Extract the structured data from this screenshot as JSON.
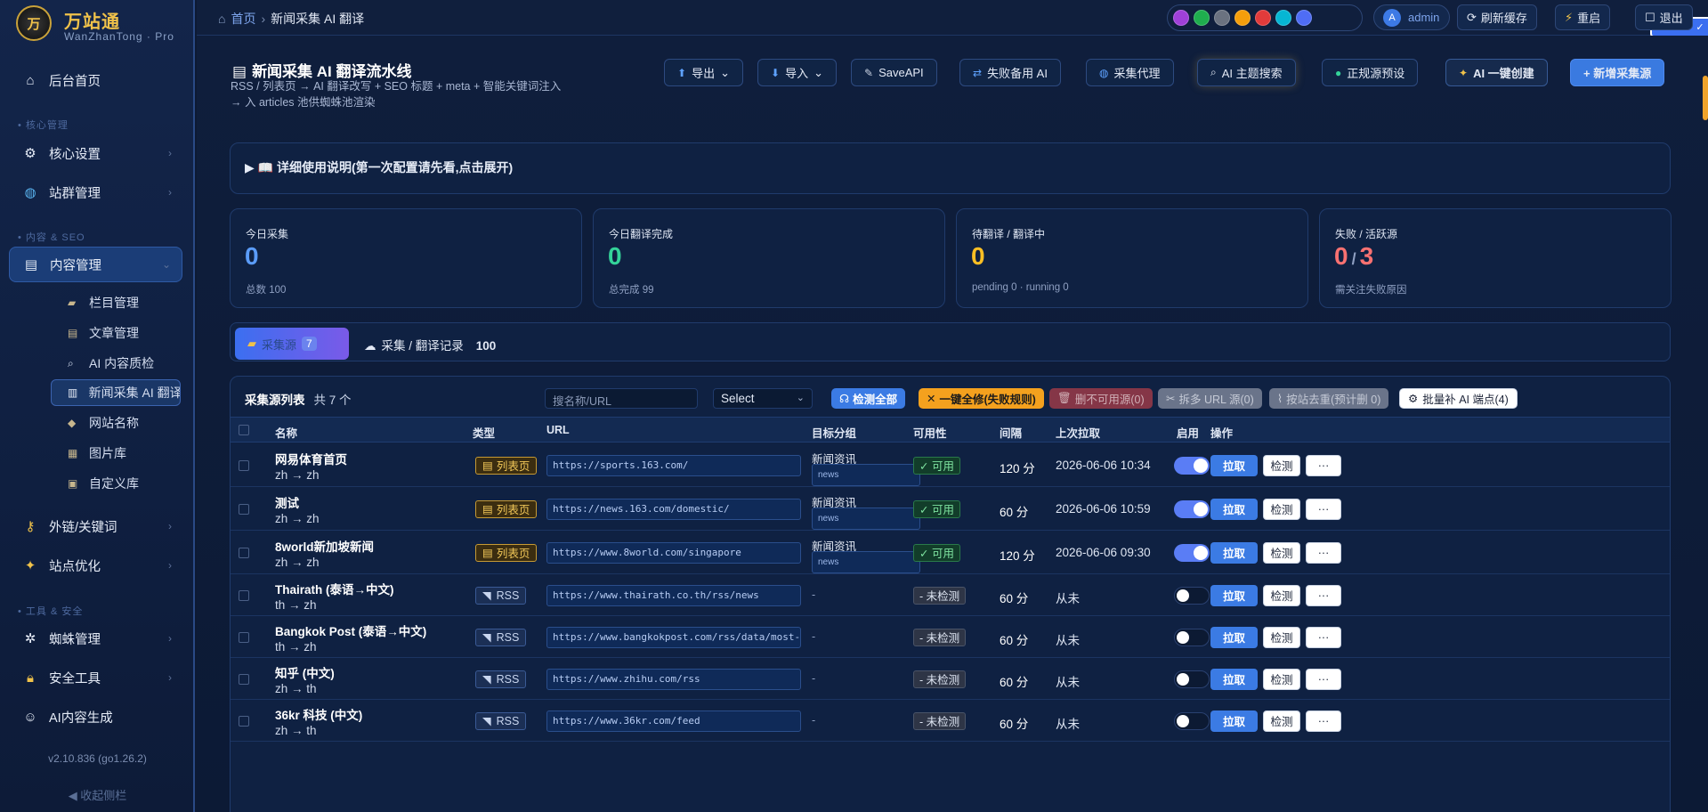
{
  "sidebar": {
    "brand": "万站通",
    "brand_sub": "WanZhanTong · Pro",
    "logo_text": "万",
    "items": [
      {
        "label": "后台首页",
        "icon": "home-icon"
      },
      {
        "label": "核心设置",
        "icon": "gear-icon"
      },
      {
        "label": "站群管理",
        "icon": "globe-icon"
      },
      {
        "label": "内容管理",
        "icon": "document-icon"
      },
      {
        "label": "外链/关键词",
        "icon": "key-icon"
      },
      {
        "label": "站点优化",
        "icon": "sparkle-icon"
      },
      {
        "label": "蜘蛛管理",
        "icon": "spider-icon"
      },
      {
        "label": "安全工具",
        "icon": "lock-icon"
      },
      {
        "label": "AI内容生成",
        "icon": "robot-icon"
      }
    ],
    "sections": [
      "核心管理",
      "内容 & SEO",
      "工具 & 安全"
    ],
    "sub_items": [
      "栏目管理",
      "文章管理",
      "AI 内容质检",
      "新闻采集 AI 翻译",
      "网站名称",
      "图片库",
      "自定义库"
    ],
    "version": "v2.10.836 (go1.26.2)",
    "collapse": "◀ 收起侧栏"
  },
  "topbar": {
    "home": "首页",
    "current": "新闻采集 AI 翻译",
    "user": "admin",
    "avatar": "A",
    "refresh": "刷新缓存",
    "restart": "重启",
    "logout": "退出"
  },
  "theme_colors": [
    "#3b6ff0",
    "#a040d8",
    "#1fae4e",
    "#6b7280",
    "#f59e0b",
    "#e23b3b",
    "#06b6d4",
    "#4f6df5"
  ],
  "header": {
    "title": "新闻采集 AI 翻译流水线",
    "desc": "RSS / 列表页 → AI 翻译改写 + SEO 标题 + meta + 智能关键词注入 → 入 articles 池供蜘蛛池渲染",
    "buttons": [
      "导出",
      "导入",
      "SaveAPI",
      "失败备用 AI",
      "采集代理",
      "AI 主题搜索",
      "正规源预设",
      "AI 一键创建",
      "+ 新增采集源"
    ]
  },
  "guide": "▶  📖 详细使用说明(第一次配置请先看,点击展开)",
  "stats": [
    {
      "label": "今日采集",
      "value": "0",
      "sub": "总数 100",
      "color": "#5b9cf8"
    },
    {
      "label": "今日翻译完成",
      "value": "0",
      "sub": "总完成 99",
      "color": "#34d399"
    },
    {
      "label": "待翻译 / 翻译中",
      "value": "0",
      "sub": "pending 0 · running 0",
      "color": "#fbbf24"
    },
    {
      "label": "失败 / 活跃源",
      "value_a": "0",
      "sep": "/",
      "value_b": "3",
      "sub": "需关注失败原因",
      "color": "#f87171"
    }
  ],
  "tabs": {
    "t1": "采集源",
    "t1_count": "7",
    "t2": "采集 / 翻译记录",
    "t2_count": "100"
  },
  "table": {
    "title": "采集源列表",
    "count": "共 7 个",
    "search_placeholder": "搜名称/URL",
    "select": "Select",
    "actions": [
      "检测全部",
      "一键全修(失败规则)",
      "删不可用源(0)",
      "拆多 URL 源(0)",
      "按站去重(预计删 0)",
      "批量补 AI 端点(4)"
    ],
    "headers": [
      "名称",
      "类型",
      "URL",
      "目标分组",
      "可用性",
      "间隔",
      "上次拉取",
      "启用",
      "操作"
    ],
    "rows": [
      {
        "name": "网易体育首页",
        "lang": "zh → zh",
        "type": "列表页",
        "url": "https://sports.163.com/",
        "group": "新闻资讯",
        "tag": "news",
        "avail": "✓ 可用",
        "interval": "120 分",
        "last": "2026-06-06 10:34",
        "on": true
      },
      {
        "name": "测试",
        "lang": "zh → zh",
        "type": "列表页",
        "url": "https://news.163.com/domestic/",
        "group": "新闻资讯",
        "tag": "news",
        "avail": "✓ 可用",
        "interval": "60 分",
        "last": "2026-06-06 10:59",
        "on": true
      },
      {
        "name": "8world新加坡新闻",
        "lang": "zh → zh",
        "type": "列表页",
        "url": "https://www.8world.com/singapore",
        "group": "新闻资讯",
        "tag": "news",
        "avail": "✓ 可用",
        "interval": "120 分",
        "last": "2026-06-06 09:30",
        "on": true
      },
      {
        "name": "Thairath (泰语→中文)",
        "lang": "th → zh",
        "type": "RSS",
        "url": "https://www.thairath.co.th/rss/news",
        "group": "-",
        "tag": "",
        "avail": "- 未检测",
        "interval": "60 分",
        "last": "从未",
        "on": false
      },
      {
        "name": "Bangkok Post (泰语→中文)",
        "lang": "th → zh",
        "type": "RSS",
        "url": "https://www.bangkokpost.com/rss/data/most-recent.xml",
        "group": "-",
        "tag": "",
        "avail": "- 未检测",
        "interval": "60 分",
        "last": "从未",
        "on": false
      },
      {
        "name": "知乎 (中文)",
        "lang": "zh → th",
        "type": "RSS",
        "url": "https://www.zhihu.com/rss",
        "group": "-",
        "tag": "",
        "avail": "- 未检测",
        "interval": "60 分",
        "last": "从未",
        "on": false
      },
      {
        "name": "36kr 科技 (中文)",
        "lang": "zh → th",
        "type": "RSS",
        "url": "https://www.36kr.com/feed",
        "group": "-",
        "tag": "",
        "avail": "- 未检测",
        "interval": "60 分",
        "last": "从未",
        "on": false
      }
    ],
    "op_pull": "拉取",
    "op_check": "检测",
    "op_more": "···"
  }
}
